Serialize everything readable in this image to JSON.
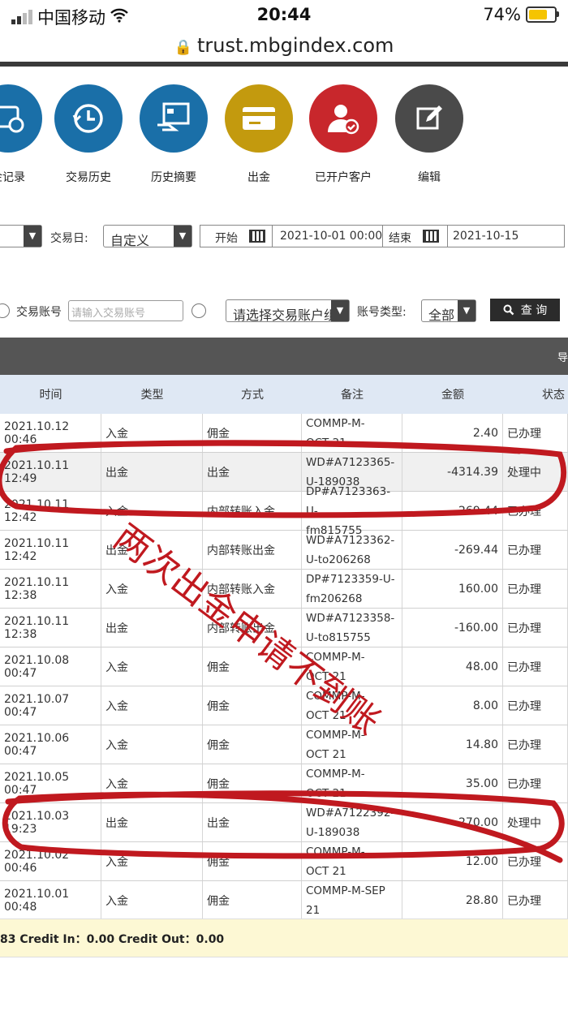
{
  "status_bar": {
    "carrier": "中国移动",
    "time": "20:44",
    "battery": "74%",
    "battery_level": 0.74
  },
  "browser": {
    "url": "trust.mbgindex.com"
  },
  "toolbar": [
    {
      "label": "金记录",
      "icon": "deposit-record-icon",
      "color": "#1a6fa8"
    },
    {
      "label": "交易历史",
      "icon": "clock-history-icon",
      "color": "#1a6fa8"
    },
    {
      "label": "历史摘要",
      "icon": "summary-icon",
      "color": "#1a6fa8"
    },
    {
      "label": "出金",
      "icon": "card-withdraw-icon",
      "color": "#c39a0e"
    },
    {
      "label": "已开户客户",
      "icon": "customer-check-icon",
      "color": "#c8272c"
    },
    {
      "label": "编辑",
      "icon": "edit-icon",
      "color": "#4a4a4a"
    }
  ],
  "filters": {
    "trade_day_label": "交易日:",
    "trade_day_value": "自定义",
    "start_label": "开始",
    "start_value": "2021-10-01 00:00",
    "end_label": "结束",
    "end_value": "2021-10-15"
  },
  "search": {
    "account_label": "交易账号",
    "account_placeholder": "请输入交易账号",
    "group_select": "请选择交易账户组",
    "type_label": "账号类型:",
    "type_value": "全部",
    "query_button": "查 询"
  },
  "darkbar_text": "导",
  "table": {
    "headers": [
      "时间",
      "类型",
      "方式",
      "备注",
      "金额",
      "状态"
    ],
    "rows": [
      {
        "time": "2021.10.12 00:46",
        "type": "入金",
        "method": "佣金",
        "note": "COMMP-M-\nOCT 21",
        "amount": "2.40",
        "status": "已办理"
      },
      {
        "time": "2021.10.11 12:49",
        "type": "出金",
        "method": "出金",
        "note": "WD#A7123365-\nU-189038",
        "amount": "-4314.39",
        "status": "处理中"
      },
      {
        "time": "2021.10.11 12:42",
        "type": "入金",
        "method": "内部转账入金",
        "note": "DP#A7123363-U-\nfm815755",
        "amount": "269.44",
        "status": "已办理"
      },
      {
        "time": "2021.10.11 12:42",
        "type": "出金",
        "method": "内部转账出金",
        "note": "WD#A7123362-\nU-to206268",
        "amount": "-269.44",
        "status": "已办理"
      },
      {
        "time": "2021.10.11 12:38",
        "type": "入金",
        "method": "内部转账入金",
        "note": "DP#7123359-U-\nfm206268",
        "amount": "160.00",
        "status": "已办理"
      },
      {
        "time": "2021.10.11 12:38",
        "type": "出金",
        "method": "内部转账出金",
        "note": "WD#A7123358-\nU-to815755",
        "amount": "-160.00",
        "status": "已办理"
      },
      {
        "time": "2021.10.08 00:47",
        "type": "入金",
        "method": "佣金",
        "note": "COMMP-M-\nOCT 21",
        "amount": "48.00",
        "status": "已办理"
      },
      {
        "time": "2021.10.07 00:47",
        "type": "入金",
        "method": "佣金",
        "note": "COMMP-M-\nOCT 21",
        "amount": "8.00",
        "status": "已办理"
      },
      {
        "time": "2021.10.06 00:47",
        "type": "入金",
        "method": "佣金",
        "note": "COMMP-M-\nOCT 21",
        "amount": "14.80",
        "status": "已办理"
      },
      {
        "time": "2021.10.05 00:47",
        "type": "入金",
        "method": "佣金",
        "note": "COMMP-M-\nOCT 21",
        "amount": "35.00",
        "status": "已办理"
      },
      {
        "time": "2021.10.03 19:23",
        "type": "出金",
        "method": "出金",
        "note": "WD#A7122392-\nU-189038",
        "amount": "-270.00",
        "status": "处理中"
      },
      {
        "time": "2021.10.02 00:46",
        "type": "入金",
        "method": "佣金",
        "note": "COMMP-M-\nOCT 21",
        "amount": "12.00",
        "status": "已办理"
      },
      {
        "time": "2021.10.01 00:48",
        "type": "入金",
        "method": "佣金",
        "note": "COMMP-M-SEP\n21",
        "amount": "28.80",
        "status": "已办理"
      }
    ]
  },
  "footer": {
    "summary": "83 Credit In：0.00 Credit Out：0.00"
  },
  "annotation": {
    "text": "两次出金申请不到账",
    "color": "#c0191f"
  }
}
